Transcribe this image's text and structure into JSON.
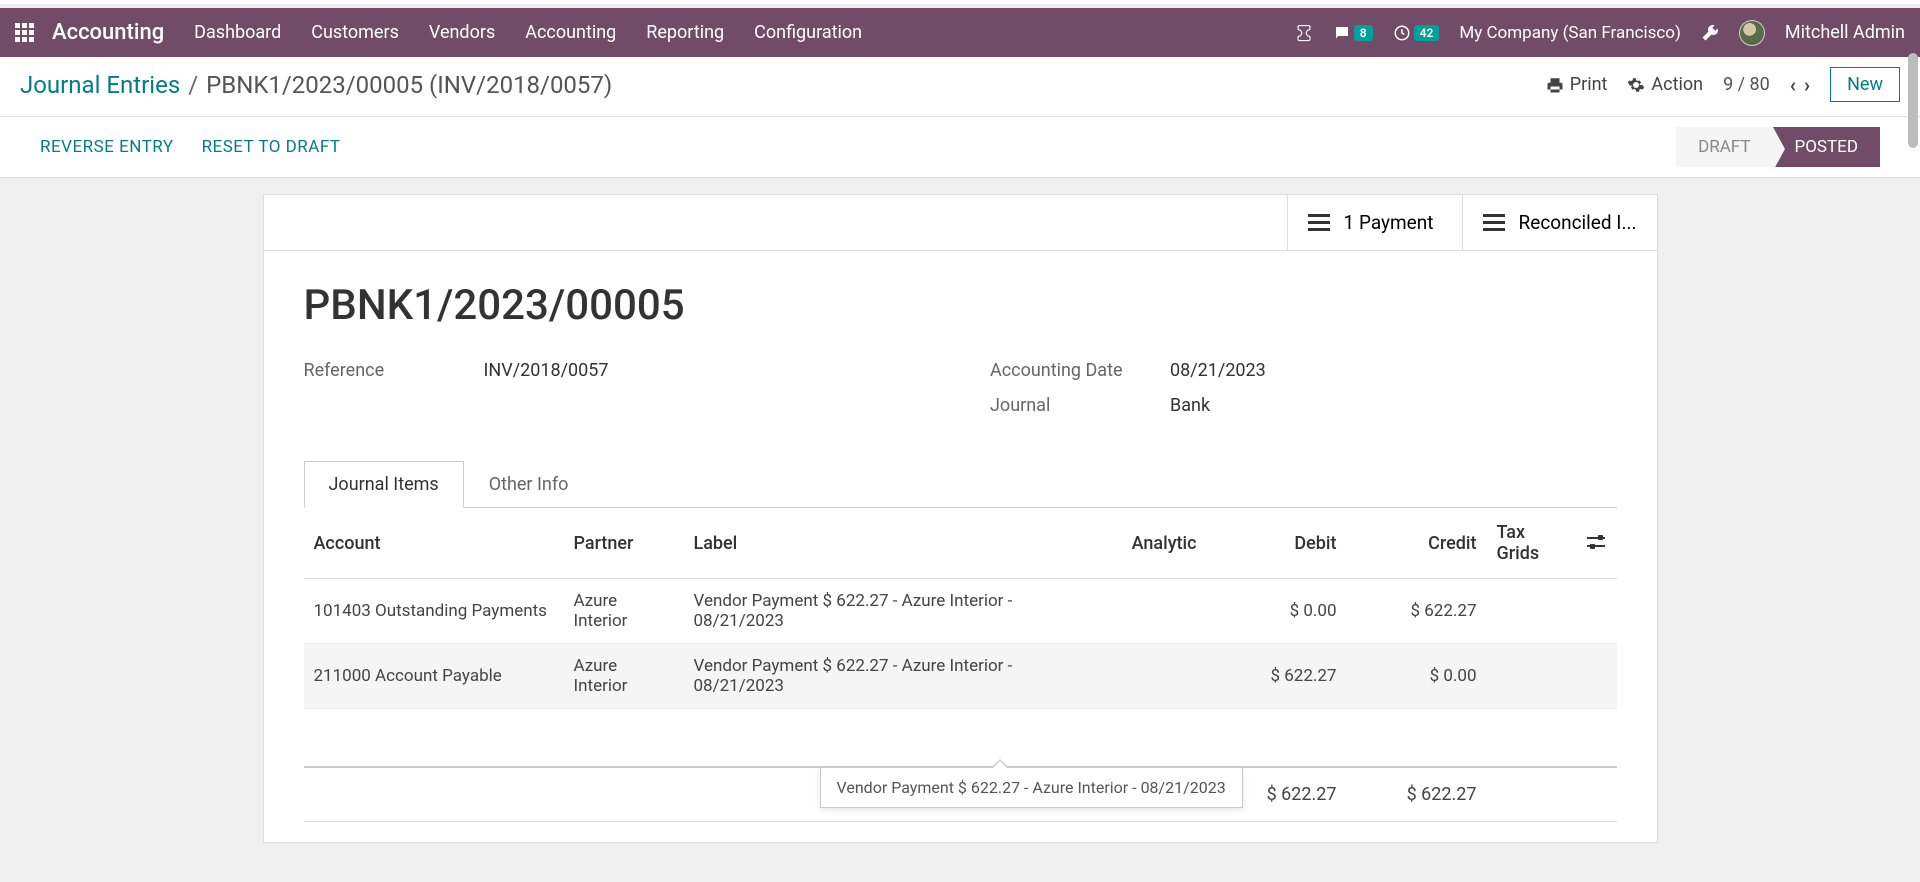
{
  "nav": {
    "app_title": "Accounting",
    "menu": [
      "Dashboard",
      "Customers",
      "Vendors",
      "Accounting",
      "Reporting",
      "Configuration"
    ],
    "badges": {
      "messages": "8",
      "activities": "42"
    },
    "company": "My Company (San Francisco)",
    "user": "Mitchell Admin"
  },
  "breadcrumb": {
    "root": "Journal Entries",
    "current": "PBNK1/2023/00005 (INV/2018/0057)"
  },
  "controls": {
    "print": "Print",
    "action": "Action",
    "pager": "9 / 80",
    "new": "New"
  },
  "statusbar": {
    "actions": [
      "REVERSE ENTRY",
      "RESET TO DRAFT"
    ],
    "states": {
      "draft": "DRAFT",
      "posted": "POSTED"
    }
  },
  "buttonbox": {
    "payment": "1 Payment",
    "reconciled": "Reconciled I..."
  },
  "form": {
    "title": "PBNK1/2023/00005",
    "reference_label": "Reference",
    "reference_value": "INV/2018/0057",
    "date_label": "Accounting Date",
    "date_value": "08/21/2023",
    "journal_label": "Journal",
    "journal_value": "Bank"
  },
  "tabs": {
    "items": "Journal Items",
    "other": "Other Info"
  },
  "table": {
    "headers": {
      "account": "Account",
      "partner": "Partner",
      "label": "Label",
      "analytic": "Analytic",
      "debit": "Debit",
      "credit": "Credit",
      "tax": "Tax Grids"
    },
    "rows": [
      {
        "account": "101403 Outstanding Payments",
        "partner": "Azure Interior",
        "label": "Vendor Payment $ 622.27 - Azure Interior - 08/21/2023",
        "analytic": "",
        "debit": "$ 0.00",
        "credit": "$ 622.27",
        "tax": ""
      },
      {
        "account": "211000 Account Payable",
        "partner": "Azure Interior",
        "label": "Vendor Payment $ 622.27 - Azure Interior - 08/21/2023",
        "analytic": "",
        "debit": "$ 622.27",
        "credit": "$ 0.00",
        "tax": ""
      }
    ],
    "totals": {
      "debit": "$ 622.27",
      "credit": "$ 622.27"
    }
  },
  "tooltip": "Vendor Payment $ 622.27 - Azure Interior - 08/21/2023"
}
